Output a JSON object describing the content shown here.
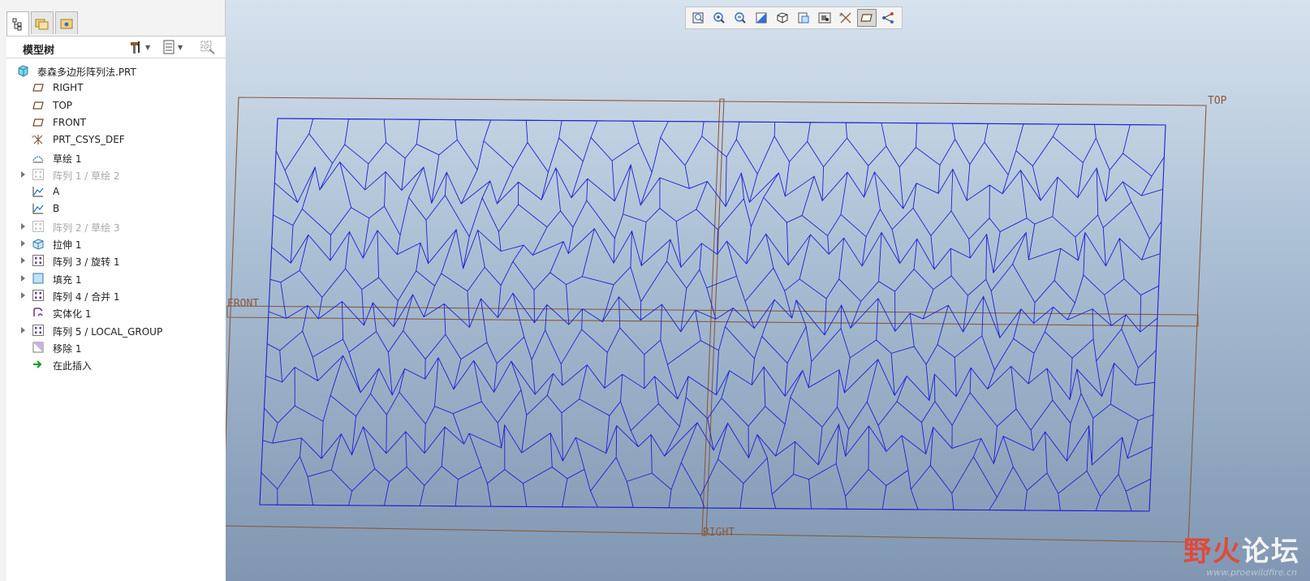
{
  "model_tree": {
    "title": "模型树",
    "items": [
      {
        "label": "泰森多边形阵列法.PRT",
        "icon": "part-icon",
        "expandable": false,
        "dim": false,
        "root": true
      },
      {
        "label": "RIGHT",
        "icon": "datum-plane-icon",
        "expandable": false,
        "dim": false
      },
      {
        "label": "TOP",
        "icon": "datum-plane-icon",
        "expandable": false,
        "dim": false
      },
      {
        "label": "FRONT",
        "icon": "datum-plane-icon",
        "expandable": false,
        "dim": false
      },
      {
        "label": "PRT_CSYS_DEF",
        "icon": "csys-icon",
        "expandable": false,
        "dim": false
      },
      {
        "label": "草绘 1",
        "icon": "sketch-icon",
        "expandable": false,
        "dim": false
      },
      {
        "label": "阵列 1 / 草绘 2",
        "icon": "pattern-icon",
        "expandable": true,
        "dim": true
      },
      {
        "label": "A",
        "icon": "graph-icon",
        "expandable": false,
        "dim": false
      },
      {
        "label": "B",
        "icon": "graph-icon",
        "expandable": false,
        "dim": false
      },
      {
        "label": "阵列 2 / 草绘 3",
        "icon": "pattern-icon",
        "expandable": true,
        "dim": true
      },
      {
        "label": "拉伸 1",
        "icon": "extrude-icon",
        "expandable": true,
        "dim": false
      },
      {
        "label": "阵列 3 / 旋转 1",
        "icon": "pattern-icon",
        "expandable": true,
        "dim": false
      },
      {
        "label": "填充 1",
        "icon": "fill-icon",
        "expandable": true,
        "dim": false
      },
      {
        "label": "阵列 4 / 合并 1",
        "icon": "pattern-icon",
        "expandable": true,
        "dim": false
      },
      {
        "label": "实体化 1",
        "icon": "solidify-icon",
        "expandable": false,
        "dim": false
      },
      {
        "label": "阵列 5 / LOCAL_GROUP",
        "icon": "pattern-icon",
        "expandable": true,
        "dim": false
      },
      {
        "label": "移除 1",
        "icon": "remove-icon",
        "expandable": false,
        "dim": false
      },
      {
        "label": "在此插入",
        "icon": "insert-arrow-icon",
        "expandable": false,
        "dim": false
      }
    ]
  },
  "panel_tabs": [
    "model-tree-tab-icon",
    "folder-browser-tab-icon",
    "favorites-tab-icon"
  ],
  "view_toolbar": [
    "refit-icon",
    "zoom-in-icon",
    "zoom-out-icon",
    "repaint-icon",
    "display-style-icon",
    "saved-orientations-icon",
    "view-manager-icon",
    "datum-display-icon",
    "plane-display-icon",
    "spin-center-icon"
  ],
  "graphics": {
    "plane_labels": {
      "top": "TOP",
      "front": "FRONT",
      "right": "RIGHT"
    }
  },
  "watermark": {
    "part1": "野火",
    "part2": "论坛",
    "url": "www.proewildfire.cn"
  },
  "colors": {
    "mesh": "#1b22d6",
    "datum": "#8a5a3c",
    "accent": "#e04a3a"
  }
}
